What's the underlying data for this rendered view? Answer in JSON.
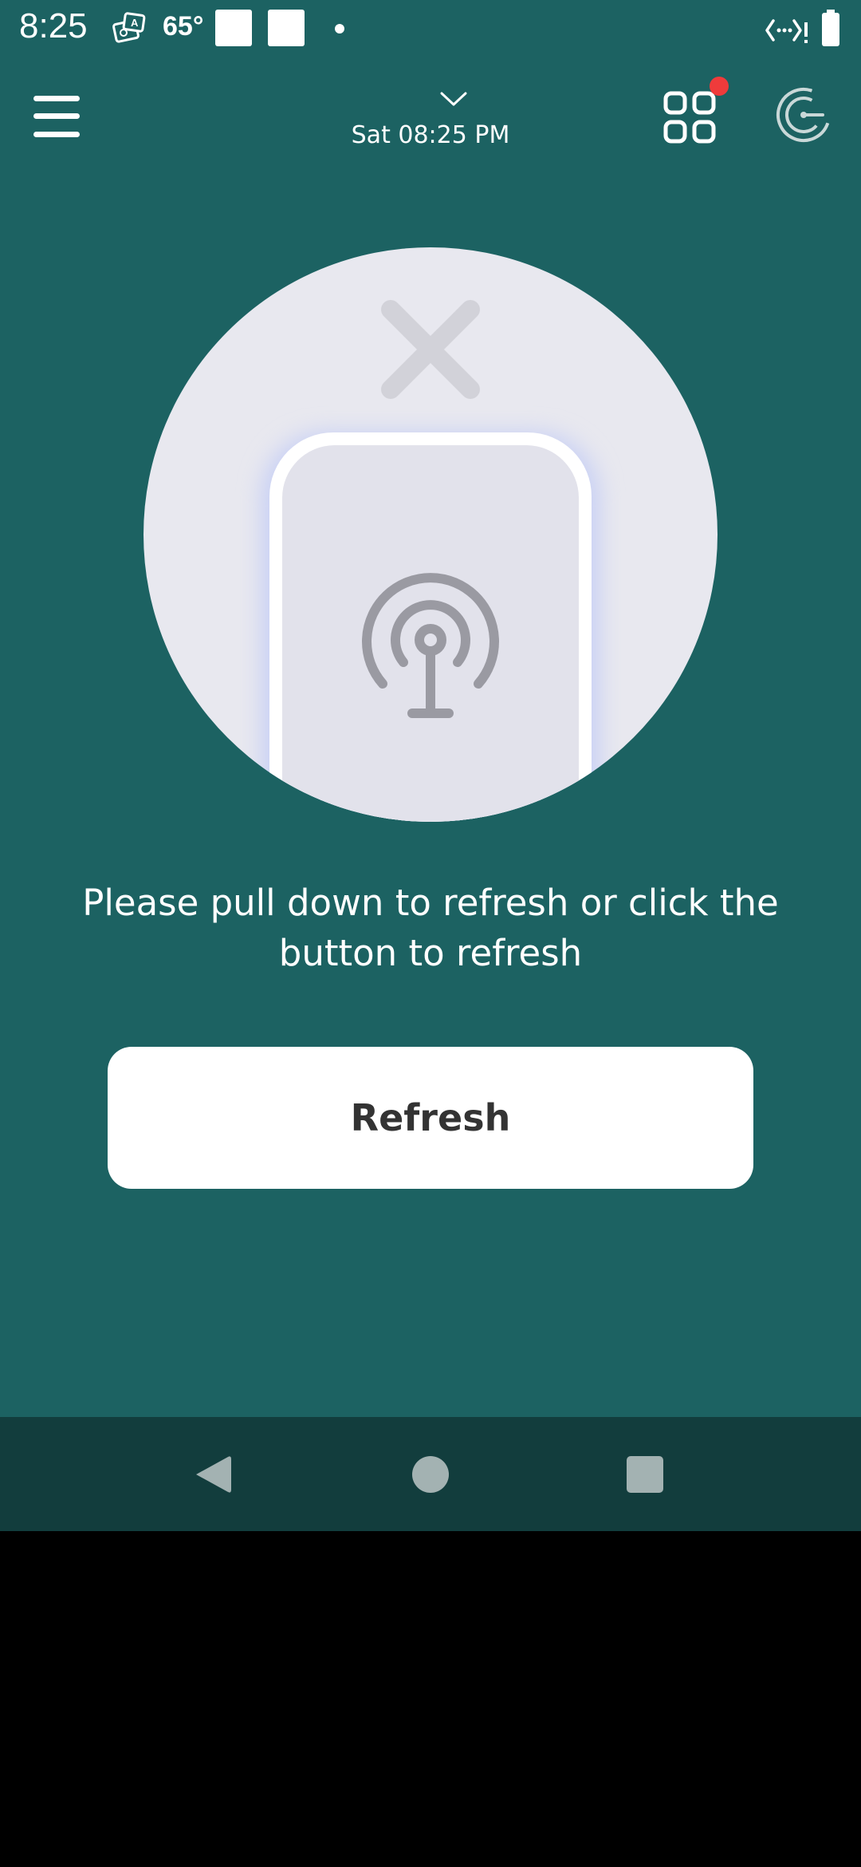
{
  "status_bar": {
    "time": "8:25",
    "temperature": "65°",
    "icons": [
      "translate-notification-icon",
      "square-notification-icon",
      "square-notification-icon",
      "dot-icon",
      "signal-icon",
      "battery-icon"
    ]
  },
  "header": {
    "menu_icon": "menu-icon",
    "date_label": "Sat 08:25 PM",
    "chevron_icon": "chevron-down-icon",
    "apps_icon": "grid-apps-icon",
    "badge_color": "#ef3b3b",
    "logo_icon": "brand-logo-icon"
  },
  "illustration": {
    "icons": [
      "close-x-icon",
      "phone-outline",
      "broadcast-signal-icon"
    ]
  },
  "main": {
    "message": "Please pull down to refresh or click the button to refresh",
    "refresh_label": "Refresh"
  },
  "colors": {
    "background": "#1c6262",
    "nav_bar": "#123d3d",
    "button": "#ffffff",
    "button_text": "#333333"
  },
  "nav_bar": {
    "icons": [
      "back-icon",
      "home-icon",
      "recents-icon"
    ]
  }
}
